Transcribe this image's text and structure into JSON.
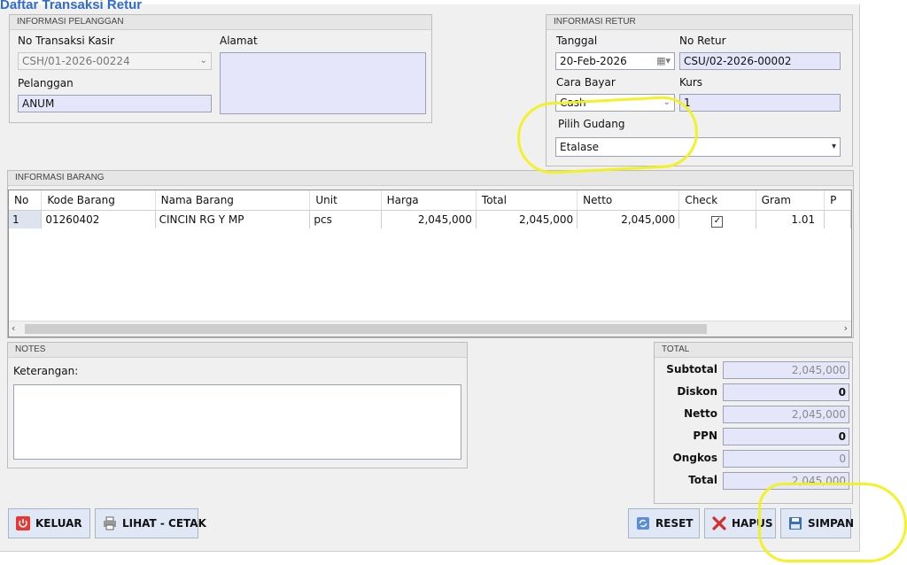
{
  "window_title_partial": "Daftar Transaksi Retur",
  "customer": {
    "section_title": "INFORMASI PELANGGAN",
    "no_transaksi_label": "No Transaksi Kasir",
    "no_transaksi_value": "CSH/01-2026-00224",
    "alamat_label": "Alamat",
    "pelanggan_label": "Pelanggan",
    "pelanggan_value": "ANUM"
  },
  "retur": {
    "section_title": "INFORMASI RETUR",
    "tanggal_label": "Tanggal",
    "tanggal_value": "20-Feb-2026",
    "no_retur_label": "No Retur",
    "no_retur_value": "CSU/02-2026-00002",
    "cara_bayar_label": "Cara Bayar",
    "cara_bayar_value": "Cash",
    "kurs_label": "Kurs",
    "kurs_value": "1",
    "gudang_label": "Pilih Gudang",
    "gudang_value": "Etalase"
  },
  "items": {
    "section_title": "INFORMASI BARANG",
    "columns": [
      "No",
      "Kode Barang",
      "Nama Barang",
      "Unit",
      "Harga",
      "Total",
      "Netto",
      "Check",
      "Gram",
      "P"
    ],
    "rows": [
      {
        "no": "1",
        "kode": "01260402",
        "nama": "CINCIN RG Y MP",
        "unit": "pcs",
        "harga": "2,045,000",
        "total": "2,045,000",
        "netto": "2,045,000",
        "checked": true,
        "gram": "1.01"
      }
    ]
  },
  "notes": {
    "section_title": "NOTES",
    "keterangan_label": "Keterangan:",
    "keterangan_value": ""
  },
  "totals": {
    "section_title": "TOTAL",
    "subtotal_label": "Subtotal",
    "subtotal_value": "2,045,000",
    "diskon_label": "Diskon",
    "diskon_value": "0",
    "netto_label": "Netto",
    "netto_value": "2,045,000",
    "ppn_label": "PPN",
    "ppn_value": "0",
    "ongkos_label": "Ongkos",
    "ongkos_value": "0",
    "total_label": "Total",
    "total_value": "2,045,000"
  },
  "buttons": {
    "keluar": "KELUAR",
    "lihat_cetak": "LIHAT - CETAK",
    "reset": "RESET",
    "hapus": "HAPUS",
    "simpan": "SIMPAN"
  },
  "colors": {
    "field_fill": "#e6e6fa",
    "highlight": "#f1f11b",
    "button_fill": "#dfe8f4"
  }
}
